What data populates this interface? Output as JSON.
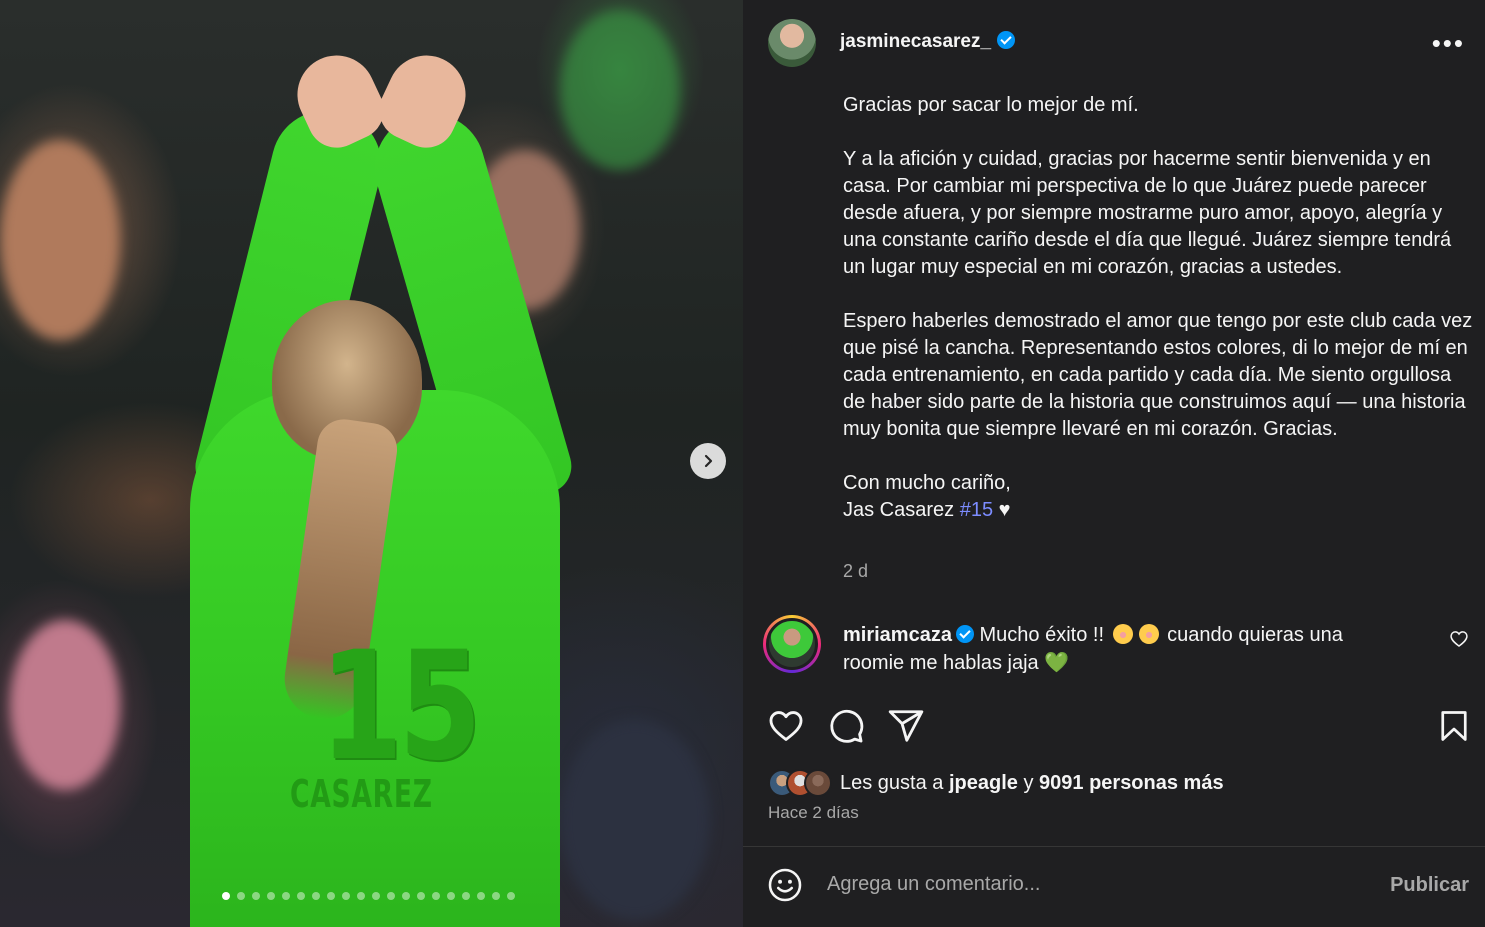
{
  "post": {
    "username": "jasminecasarez_",
    "more_label": "•••",
    "jersey_number": "15",
    "jersey_name": "CASAREZ",
    "carousel_dot_count": 20,
    "carousel_active_index": 0
  },
  "caption": {
    "paragraphs": [
      "Gracias por sacar lo mejor de mí.",
      "Y a la afición y cuidad, gracias por hacerme sentir bienvenida y en casa. Por cambiar mi perspectiva de lo que Juárez puede parecer desde afuera, y por siempre mostrarme puro amor, apoyo, alegría y una constante cariño desde el día que llegué. Juárez siempre tendrá un lugar muy especial en mi corazón, gracias a ustedes.",
      "Espero haberles demostrado el amor que tengo por este club cada vez que pisé la cancha. Representando estos colores, di lo mejor de mí en cada entrenamiento, en cada partido y cada día. Me siento orgullosa de haber sido parte de la historia que construimos aquí — una historia muy bonita que siempre llevaré en mi corazón. Gracias."
    ],
    "signoff_line1": "Con mucho cariño,",
    "signoff_name": "Jas Casarez ",
    "hashtag": "#15",
    "signoff_heart": " ♥",
    "time": "2 d"
  },
  "comment": {
    "user": "miriamcaza",
    "text_part1": " Mucho éxito !! ",
    "text_part2": " cuando quieras una roomie me hablas jaja ",
    "heart": "💚"
  },
  "likes": {
    "prefix": "Les gusta a ",
    "user": "jpeagle",
    "middle": " y ",
    "count_text": "9091 personas más",
    "time": "Hace 2 días"
  },
  "comment_box": {
    "placeholder": "Agrega un comentario...",
    "publish_label": "Publicar"
  },
  "colors": {
    "panel_bg": "#1f1f21",
    "verified": "#0095f6",
    "hashtag": "#7c8cff",
    "secondary_text": "#a8a8a8",
    "jersey_green": "#3fd82c"
  }
}
